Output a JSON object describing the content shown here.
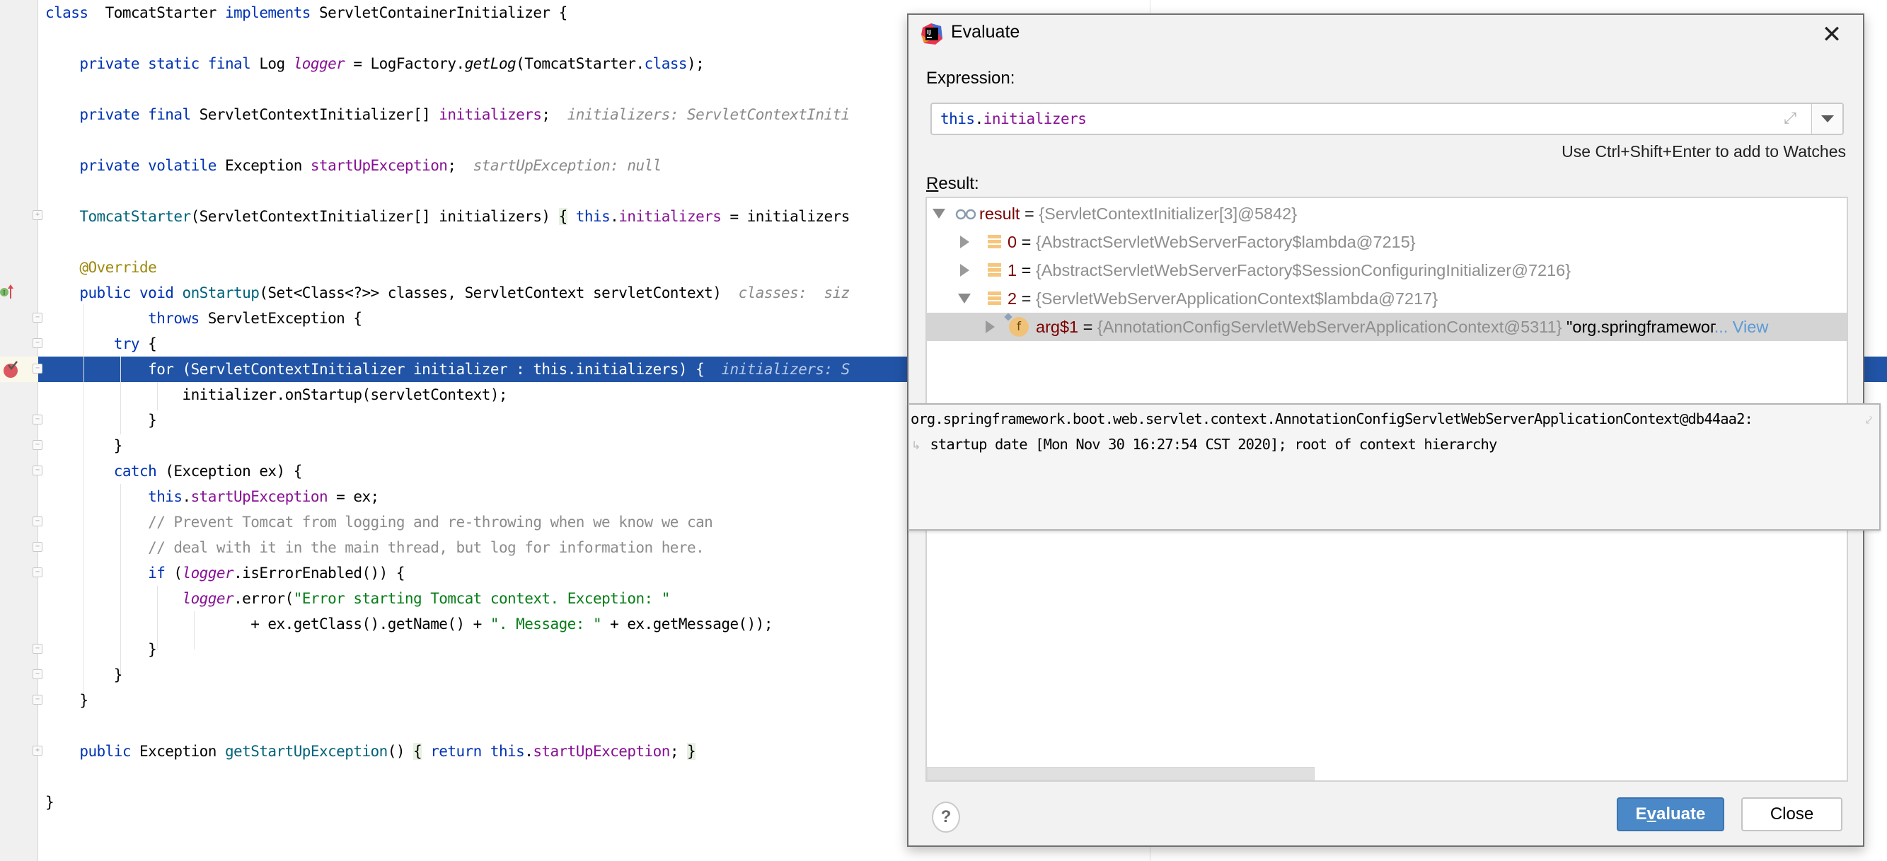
{
  "editor": {
    "lines": [
      {
        "tokens": [
          [
            "kw",
            "class"
          ],
          [
            "",
            "  TomcatStarter "
          ],
          [
            "kw",
            "implements"
          ],
          [
            "",
            " ServletContainerInitializer {"
          ]
        ]
      },
      {
        "tokens": []
      },
      {
        "tokens": [
          [
            "",
            "    "
          ],
          [
            "kw",
            "private static final"
          ],
          [
            "",
            " Log "
          ],
          [
            "static",
            "logger"
          ],
          [
            "",
            " = LogFactory."
          ],
          [
            "smeth",
            "getLog"
          ],
          [
            "",
            "(TomcatStarter."
          ],
          [
            "kw",
            "class"
          ],
          [
            "",
            ");"
          ]
        ]
      },
      {
        "tokens": []
      },
      {
        "tokens": [
          [
            "",
            "    "
          ],
          [
            "kw",
            "private final"
          ],
          [
            "",
            " ServletContextInitializer[] "
          ],
          [
            "field",
            "initializers"
          ],
          [
            "",
            ";  "
          ],
          [
            "hint",
            "initializers: ServletContextIniti"
          ]
        ]
      },
      {
        "tokens": []
      },
      {
        "tokens": [
          [
            "",
            "    "
          ],
          [
            "kw",
            "private volatile"
          ],
          [
            "",
            " Exception "
          ],
          [
            "field",
            "startUpException"
          ],
          [
            "",
            ";  "
          ],
          [
            "hint",
            "startUpException: null"
          ]
        ]
      },
      {
        "tokens": []
      },
      {
        "tokens": [
          [
            "",
            "    "
          ],
          [
            "decl",
            "TomcatStarter"
          ],
          [
            "",
            "(ServletContextInitializer[] initializers) "
          ],
          [
            "brace",
            "{"
          ],
          [
            "",
            " "
          ],
          [
            "kw",
            "this"
          ],
          [
            "",
            "."
          ],
          [
            "field",
            "initializers"
          ],
          [
            "",
            " = initializers"
          ]
        ]
      },
      {
        "tokens": []
      },
      {
        "tokens": [
          [
            "",
            "    "
          ],
          [
            "anno",
            "@Override"
          ]
        ]
      },
      {
        "tokens": [
          [
            "",
            "    "
          ],
          [
            "kw",
            "public void"
          ],
          [
            "",
            " "
          ],
          [
            "decl",
            "onStartup"
          ],
          [
            "",
            "(Set<Class<?>> classes, ServletContext servletContext)  "
          ],
          [
            "hint",
            "classes:  siz"
          ]
        ]
      },
      {
        "tokens": [
          [
            "",
            "            "
          ],
          [
            "kw",
            "throws"
          ],
          [
            "",
            " ServletException {"
          ]
        ]
      },
      {
        "tokens": [
          [
            "",
            "        "
          ],
          [
            "kw",
            "try"
          ],
          [
            "",
            " {"
          ]
        ]
      },
      {
        "tokens": [
          [
            "",
            "            "
          ],
          [
            "kw",
            "for"
          ],
          [
            "",
            " (ServletContextInitializer initializer : "
          ],
          [
            "kw",
            "this"
          ],
          [
            "",
            ".initializers) {  "
          ],
          [
            "hint",
            "initializers: S"
          ]
        ],
        "selected": true
      },
      {
        "tokens": [
          [
            "",
            "                initializer.onStartup(servletContext);"
          ]
        ]
      },
      {
        "tokens": [
          [
            "",
            "            }"
          ]
        ]
      },
      {
        "tokens": [
          [
            "",
            "        }"
          ]
        ]
      },
      {
        "tokens": [
          [
            "",
            "        "
          ],
          [
            "kw",
            "catch"
          ],
          [
            "",
            " (Exception ex) {"
          ]
        ]
      },
      {
        "tokens": [
          [
            "",
            "            "
          ],
          [
            "kw",
            "this"
          ],
          [
            "",
            "."
          ],
          [
            "field",
            "startUpException"
          ],
          [
            "",
            " = ex;"
          ]
        ]
      },
      {
        "tokens": [
          [
            "",
            "            "
          ],
          [
            "comment",
            "// Prevent Tomcat from logging and re-throwing when we know we can"
          ]
        ]
      },
      {
        "tokens": [
          [
            "",
            "            "
          ],
          [
            "comment",
            "// deal with it in the main thread, but log for information here."
          ]
        ]
      },
      {
        "tokens": [
          [
            "",
            "            "
          ],
          [
            "kw",
            "if"
          ],
          [
            "",
            " ("
          ],
          [
            "static",
            "logger"
          ],
          [
            "",
            ".isErrorEnabled()) {"
          ]
        ]
      },
      {
        "tokens": [
          [
            "",
            "                "
          ],
          [
            "static",
            "logger"
          ],
          [
            "",
            ".error("
          ],
          [
            "str",
            "\"Error starting Tomcat context. Exception: \""
          ]
        ]
      },
      {
        "tokens": [
          [
            "",
            "                        + ex.getClass().getName() + "
          ],
          [
            "str",
            "\". Message: \""
          ],
          [
            "",
            " + ex.getMessage());"
          ]
        ]
      },
      {
        "tokens": [
          [
            "",
            "            }"
          ]
        ]
      },
      {
        "tokens": [
          [
            "",
            "        }"
          ]
        ]
      },
      {
        "tokens": [
          [
            "",
            "    }"
          ]
        ]
      },
      {
        "tokens": []
      },
      {
        "tokens": [
          [
            "",
            "    "
          ],
          [
            "kw",
            "public"
          ],
          [
            "",
            " Exception "
          ],
          [
            "decl",
            "getStartUpException"
          ],
          [
            "",
            "() "
          ],
          [
            "brace",
            "{"
          ],
          [
            "",
            " "
          ],
          [
            "kw",
            "return this"
          ],
          [
            "",
            "."
          ],
          [
            "field",
            "startUpException"
          ],
          [
            "",
            "; "
          ],
          [
            "brace",
            "}"
          ]
        ]
      },
      {
        "tokens": []
      },
      {
        "tokens": [
          [
            "",
            "}"
          ]
        ]
      }
    ],
    "current_line_index": 14
  },
  "dialog": {
    "title": "Evaluate",
    "close_glyph": "✕",
    "expression_label": "Expression:",
    "expression_value": {
      "kw": "this",
      "dot": ".",
      "field": "initializers"
    },
    "watches_hint": "Use Ctrl+Shift+Enter to add to Watches",
    "result_label_mnemonic": "R",
    "result_label_rest": "esult:",
    "tree": [
      {
        "name": "result",
        "eq": " = ",
        "type": "{ServletContextInitializer[3]@5842}",
        "expanded": true,
        "icon": "watch-glasses-icon",
        "level": 0
      },
      {
        "name": "0",
        "eq": " = ",
        "type": "{AbstractServletWebServerFactory$lambda@7215}",
        "expanded": false,
        "icon": "array-element-icon",
        "level": 1
      },
      {
        "name": "1",
        "eq": " = ",
        "type": "{AbstractServletWebServerFactory$SessionConfiguringInitializer@7216}",
        "expanded": false,
        "icon": "array-element-icon",
        "level": 1
      },
      {
        "name": "2",
        "eq": " = ",
        "type": "{ServletWebServerApplicationContext$lambda@7217}",
        "expanded": true,
        "icon": "array-element-icon",
        "level": 1
      },
      {
        "name": "arg$1",
        "eq": " = ",
        "type": "{AnnotationConfigServletWebServerApplicationContext@5311}",
        "value": " \"org.springframewoг",
        "more": "... View",
        "expanded": false,
        "icon": "field-icon",
        "field_glyph": "f",
        "level": 2,
        "selected": true
      }
    ],
    "help_glyph": "?",
    "evaluate_mnemonic_prefix": "E",
    "evaluate_mnemonic": "v",
    "evaluate_rest": "aluate",
    "close_label": "Close"
  },
  "tooltip": {
    "line1": "org.springframework.boot.web.servlet.context.AnnotationConfigServletWebServerApplicationContext@db44aa2:",
    "line2": " startup date [Mon Nov 30 16:27:54 CST 2020]; root of context hierarchy"
  }
}
